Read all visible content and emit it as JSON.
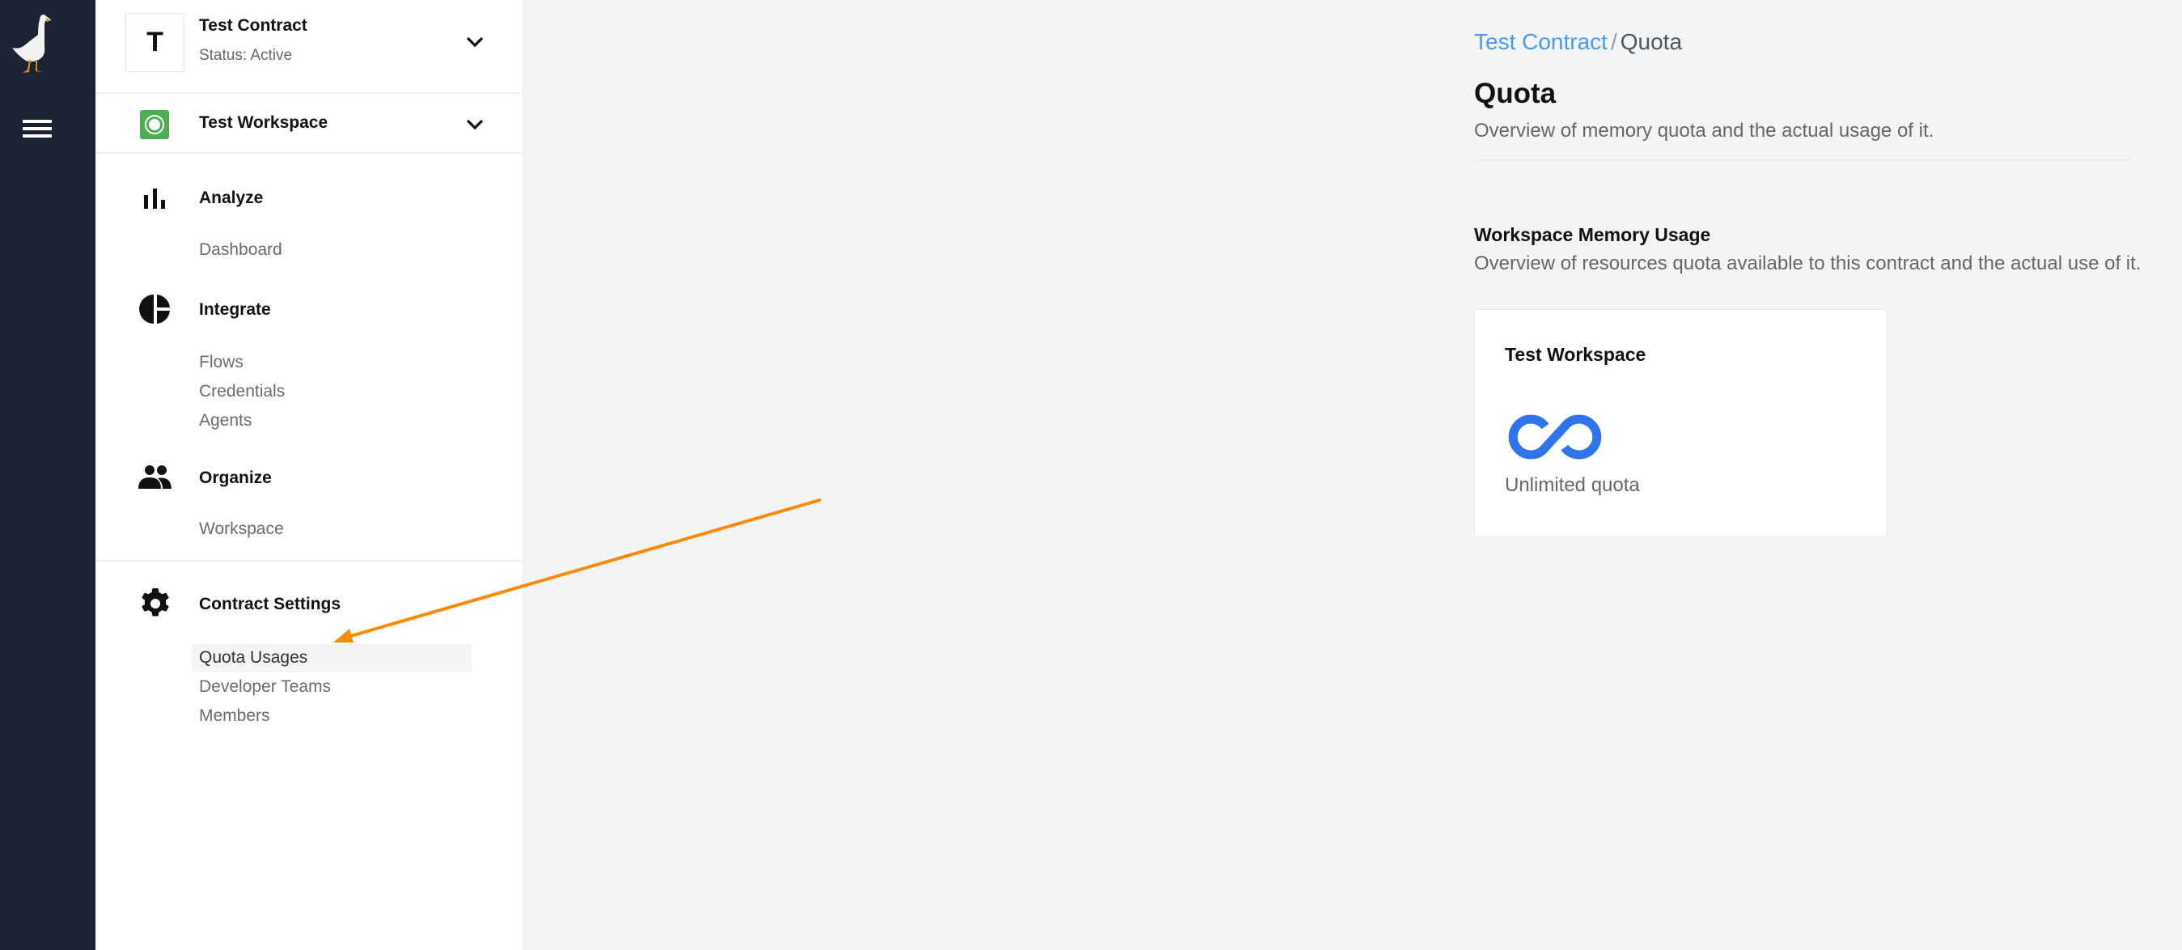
{
  "rail": {
    "logo_icon": "goose-logo",
    "menu_icon": "hamburger-menu-icon"
  },
  "sidebar": {
    "contract": {
      "avatar_letter": "T",
      "name": "Test Contract",
      "status": "Status: Active"
    },
    "workspace": {
      "name": "Test Workspace",
      "icon_color": "#4caf50"
    },
    "sections": [
      {
        "label": "Analyze",
        "icon": "bar-chart-icon",
        "items": [
          {
            "label": "Dashboard",
            "active": false
          }
        ]
      },
      {
        "label": "Integrate",
        "icon": "pie-chart-icon",
        "items": [
          {
            "label": "Flows",
            "active": false
          },
          {
            "label": "Credentials",
            "active": false
          },
          {
            "label": "Agents",
            "active": false
          }
        ]
      },
      {
        "label": "Organize",
        "icon": "people-icon",
        "items": [
          {
            "label": "Workspace",
            "active": false
          }
        ]
      },
      {
        "label": "Contract Settings",
        "icon": "gear-icon",
        "items": [
          {
            "label": "Quota Usages",
            "active": true
          },
          {
            "label": "Developer Teams",
            "active": false
          },
          {
            "label": "Members",
            "active": false
          }
        ]
      }
    ]
  },
  "main": {
    "breadcrumb": {
      "parent": "Test Contract",
      "separator": "/",
      "current": "Quota"
    },
    "title": "Quota",
    "subtitle": "Overview of memory quota and the actual usage of it.",
    "section": {
      "title": "Workspace Memory Usage",
      "subtitle": "Overview of resources quota available to this contract and the actual use of it."
    },
    "cards": [
      {
        "title": "Test Workspace",
        "icon": "infinity-icon",
        "status": "Unlimited quota"
      }
    ]
  },
  "colors": {
    "rail_bg": "#1b2334",
    "page_bg": "#f3f4f6",
    "link": "#4a9af0",
    "accent_blue": "#2f74eb",
    "annotation_arrow": "#ff8a00"
  }
}
